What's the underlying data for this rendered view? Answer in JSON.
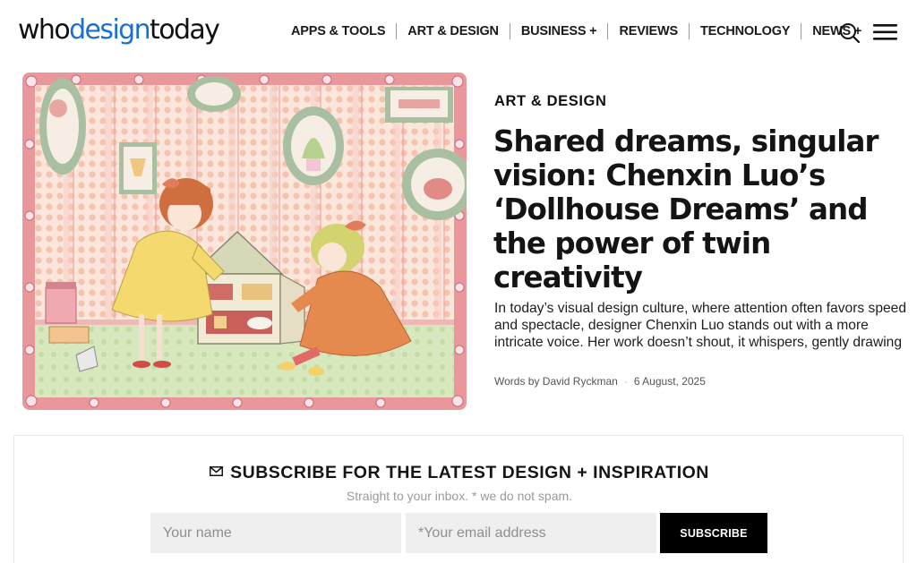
{
  "site": {
    "logo_part1": "who",
    "logo_part2": "design",
    "logo_part3": "today"
  },
  "nav": {
    "items": [
      {
        "label": "APPS & TOOLS"
      },
      {
        "label": "ART & DESIGN"
      },
      {
        "label": "BUSINESS +"
      },
      {
        "label": "REVIEWS"
      },
      {
        "label": "TECHNOLOGY"
      },
      {
        "label": "NEWS +"
      }
    ],
    "search_icon": "search-icon",
    "menu_icon": "hamburger-menu-icon"
  },
  "article": {
    "category": "ART & DESIGN",
    "headline": "Shared dreams, singular vision: Chenxin Luo’s ‘Dollhouse Dreams’ and the power of twin creativity",
    "excerpt": "In today’s visual design culture, where attention often favors speed and spectacle, designer Chenxin Luo stands out with a more intricate voice. Her work doesn’t shout, it whispers, gently drawing",
    "byline": "Words by David Ryckman",
    "separator": "·",
    "date": "6 August, 2025"
  },
  "subscribe": {
    "title": "SUBSCRIBE FOR THE LATEST DESIGN + INSPIRATION",
    "subtitle": "Straight to your inbox. * we do not spam.",
    "name_placeholder": "Your name",
    "email_placeholder": "*Your email address",
    "button_label": "SUBSCRIBE",
    "mail_icon": "mail-icon"
  },
  "colors": {
    "logo_accent": "#1b6fd1",
    "illustration_border": "#e58f8f",
    "illustration_wall": "#f8dfd2",
    "illustration_floor": "#cfe2b3",
    "button_bg": "#000000"
  }
}
